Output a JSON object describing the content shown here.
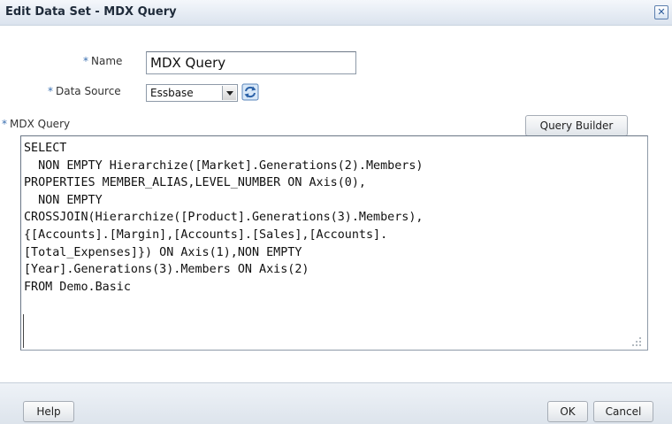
{
  "window": {
    "title": "Edit Data Set - MDX Query",
    "close_label": "✕"
  },
  "form": {
    "name_label": "Name",
    "name_value": "MDX Query",
    "datasource_label": "Data Source",
    "datasource_value": "Essbase",
    "mdx_label": "MDX Query",
    "required_marker": "*",
    "mdx_text": "SELECT\n  NON EMPTY Hierarchize([Market].Generations(2).Members)\nPROPERTIES MEMBER_ALIAS,LEVEL_NUMBER ON Axis(0),\n  NON EMPTY\nCROSSJOIN(Hierarchize([Product].Generations(3).Members),\n{[Accounts].[Margin],[Accounts].[Sales],[Accounts].\n[Total_Expenses]}) ON Axis(1),NON EMPTY\n[Year].Generations(3).Members ON Axis(2)\nFROM Demo.Basic"
  },
  "buttons": {
    "query_builder": "Query Builder",
    "help": "Help",
    "ok": "OK",
    "cancel": "Cancel"
  },
  "icons": {
    "close": "close-icon",
    "refresh": "refresh-icon",
    "dropdown": "chevron-down-icon",
    "resize": "resize-grip-icon"
  },
  "colors": {
    "title_bar": "#e6ecf4",
    "required_marker": "#3a6fb0",
    "footer": "#dde4ec"
  }
}
